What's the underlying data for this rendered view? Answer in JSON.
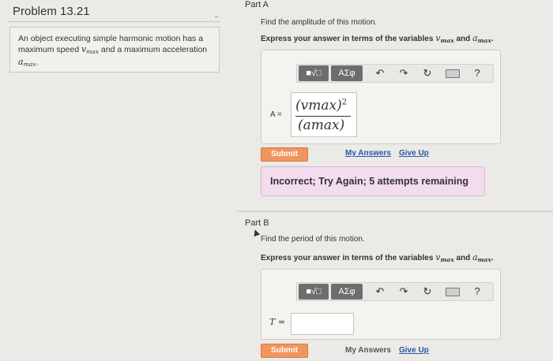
{
  "problem": {
    "title": "Problem 13.21",
    "statement_1": "An object executing simple harmonic motion has a maximum speed",
    "statement_2": "and a maximum acceleration",
    "v_symbol": "v",
    "a_symbol": "a",
    "max_sub": "max"
  },
  "part_a": {
    "label": "Part A",
    "question": "Find the amplitude of this motion.",
    "instruction": "Express your answer in terms of the variables",
    "and_word": "and",
    "answer_var": "A =",
    "answer_num": "(vmax)",
    "answer_exp": "2",
    "answer_den": "(amax)",
    "submit": "Submit",
    "my_answers": "My Answers",
    "give_up": "Give Up",
    "feedback": "Incorrect; Try Again; 5 attempts remaining"
  },
  "part_b": {
    "label": "Part B",
    "question": "Find the period of this motion.",
    "instruction": "Express your answer in terms of the variables",
    "and_word": "and",
    "answer_var": "T =",
    "answer_value": "",
    "submit": "Submit",
    "my_answers": "My Answers",
    "give_up": "Give Up"
  },
  "toolbar": {
    "templates_label": "■√□",
    "greek_label": "ΑΣφ",
    "undo_icon": "↶",
    "redo_icon": "↷",
    "reset_icon": "↻",
    "help_icon": "?"
  }
}
